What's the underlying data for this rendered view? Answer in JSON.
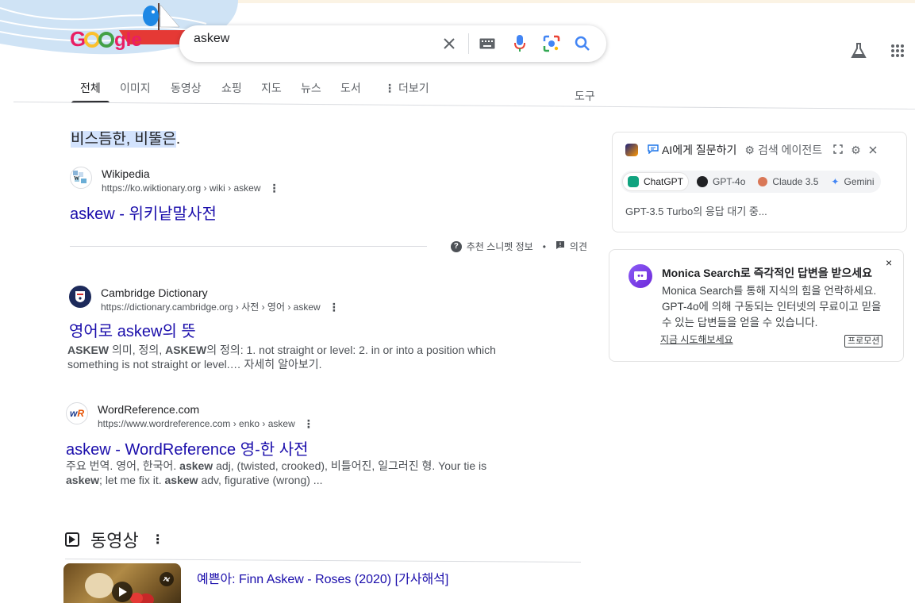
{
  "search": {
    "query": "askew"
  },
  "tabs": [
    "전체",
    "이미지",
    "동영상",
    "쇼핑",
    "지도",
    "뉴스",
    "도서",
    "더보기"
  ],
  "tools_label": "도구",
  "featured_snippet": {
    "text_highlight": "비스듬한, 비뚤은",
    "text_rest": ".",
    "source_name": "Wikipedia",
    "source_url": "https://ko.wiktionary.org › wiki › askew",
    "title": "askew - 위키낱말사전",
    "footer_about": "추천 스니펫 정보",
    "footer_sep": "•",
    "footer_feedback": "의견"
  },
  "results": [
    {
      "source_name": "Cambridge Dictionary",
      "source_url": "https://dictionary.cambridge.org › 사전 › 영어 › askew",
      "title": "영어로 askew의 뜻",
      "desc_line1_a": "ASKEW",
      "desc_line1_b": " 의미, 정의, ",
      "desc_line1_c": "ASKEW",
      "desc_line1_d": "의 정의: 1. not straight or level: 2. in or into a position which",
      "desc_line2": "something is not straight or level.… 자세히 알아보기."
    },
    {
      "source_name": "WordReference.com",
      "source_url": "https://www.wordreference.com › enko › askew",
      "title": "askew - WordReference 영-한 사전",
      "desc_line1_a": "주요 번역. 영어, 한국어. ",
      "desc_line1_b": "askew",
      "desc_line1_c": " adj, (twisted, crooked), 비틀어진, 일그러진 형. Your tie is",
      "desc_line2_a": "askew",
      "desc_line2_b": "; let me fix it. ",
      "desc_line2_c": "askew",
      "desc_line2_d": " adv, figurative (wrong) ..."
    }
  ],
  "videos": {
    "heading": "동영상",
    "items": [
      {
        "title": "예쁜아: Finn Askew - Roses (2020) [가사해석]"
      }
    ]
  },
  "ai_panel": {
    "ask_ai": "AI에게 질문하기",
    "search_agent": "검색 에이전트",
    "models": [
      "ChatGPT",
      "GPT-4o",
      "Claude 3.5",
      "Gemini"
    ],
    "status": "GPT-3.5 Turbo의 응답 대기 중..."
  },
  "monica_panel": {
    "title": "Monica Search로 즉각적인 답변을 받으세요",
    "body": "Monica Search를 통해 지식의 힘을 언락하세요. GPT-4o에 의해 구동되는 인터넷의 무료이고 믿을 수 있는 답변들을 얻을 수 있습니다.",
    "link": "지금 시도해보세요",
    "promo": "프로모션",
    "close": "×"
  },
  "colors": {
    "link": "#1a0dab",
    "accent": "#1a73e8",
    "highlight": "#d3e3fd"
  }
}
